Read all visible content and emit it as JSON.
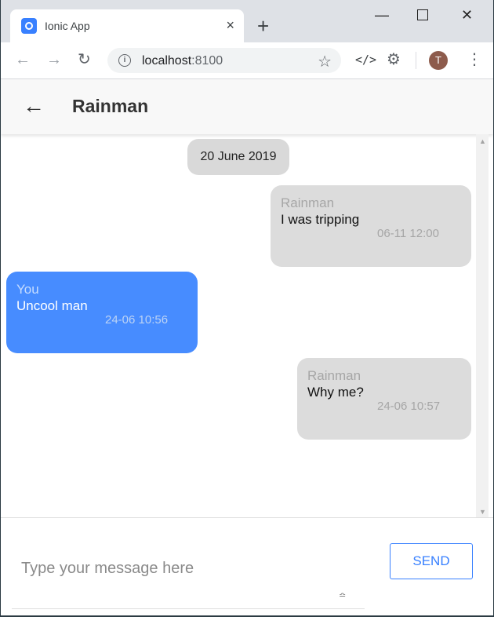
{
  "browser": {
    "tab_title": "Ionic App",
    "tab_close": "×",
    "new_tab": "+",
    "url_host": "localhost",
    "url_port": ":8100",
    "avatar_letter": "T"
  },
  "header": {
    "title": "Rainman"
  },
  "date_chip": "20 June 2019",
  "messages": [
    {
      "author": "Rainman",
      "text": "I was tripping",
      "time": "06-11 12:00",
      "from": "them"
    },
    {
      "author": "You",
      "text": "Uncool man",
      "time": "24-06 10:56",
      "from": "me"
    },
    {
      "author": "Rainman",
      "text": "Why me?",
      "time": "24-06 10:57",
      "from": "them"
    }
  ],
  "composer": {
    "placeholder": "Type your message here",
    "send_label": "SEND"
  },
  "colors": {
    "accent": "#3880ff",
    "my_bubble": "#478cff",
    "their_bubble": "#dcdcdc"
  },
  "icons": {
    "back": "arrow-left-icon",
    "close": "close-icon",
    "star": "star-icon",
    "info": "info-icon",
    "reload": "reload-icon",
    "menu": "more-vert-icon"
  }
}
